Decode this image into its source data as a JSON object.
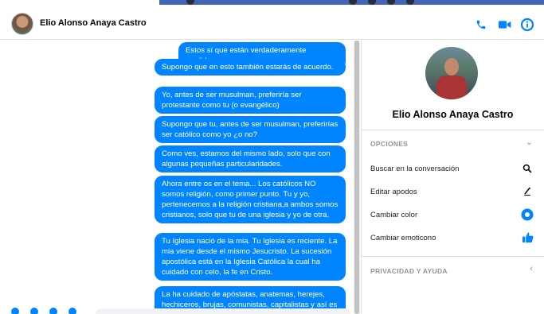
{
  "header": {
    "title": "Elio Alonso Anaya Castro"
  },
  "messages": [
    "Estos sí que están verdaderamente perdidos.",
    "Supongo que en esto también estarás de acuerdo.",
    "Yo, antes de ser musulman, preferiría ser protestante como tu (o evangélico)",
    "Supongo que tu, antes de ser musulman, preferirías ser católico como yo ¿o no?",
    "Como ves, estamos del mismo lado, solo que con algunas pequeñas particularidades.",
    "Ahora entre os en el tema... Los católicos NO somos religión, como primer punto. Tu y yo, pertenecemos a la religión cristiana,a ambos somos cristianos, solo que tu de una iglesia y yo de otra.",
    "Tu Iglesia nació de la mia. Tu Iglesia es reciente. La mia viene desde el mismo Jesucristo. La sucesión apostólica está en la Iglesia Católica la cual ha cuidado con celo, la fe en Cristo.",
    "La ha cuidado de apóstatas, anatemas, herejes, hechiceros, brujas, comunistas, capitalistas y así es"
  ],
  "sidepanel": {
    "name": "Elio Alonso Anaya Castro",
    "options_title": "OPCIONES",
    "options": [
      {
        "label": "Buscar en la conversación",
        "icon": "search-icon"
      },
      {
        "label": "Editar apodos",
        "icon": "edit-nickname-icon"
      },
      {
        "label": "Cambiar color",
        "icon": "color-circle-icon"
      },
      {
        "label": "Cambiar emoticono",
        "icon": "thumbs-up-icon"
      }
    ],
    "privacy_title": "PRIVACIDAD Y AYUDA"
  },
  "colors": {
    "accent": "#0084ff",
    "topbar": "#4267b2"
  }
}
